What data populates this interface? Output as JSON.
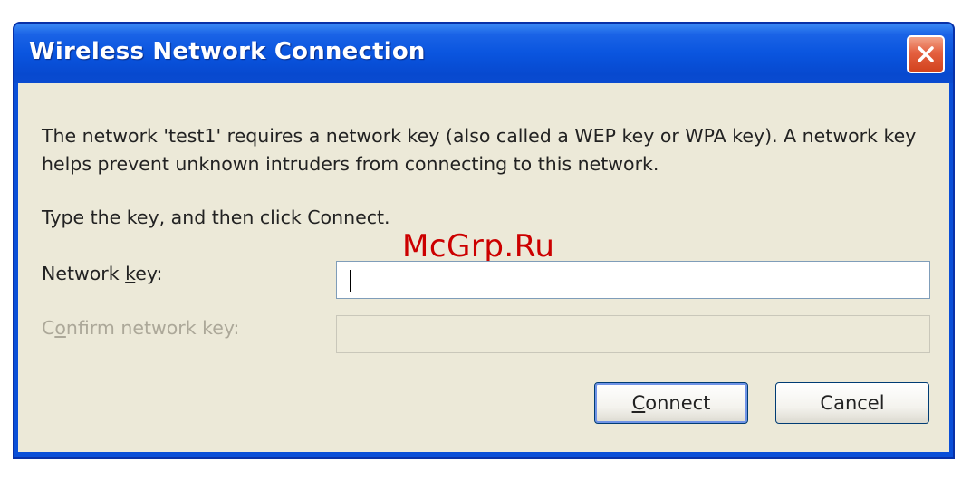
{
  "window": {
    "title": "Wireless Network Connection"
  },
  "message": {
    "line1": "The network 'test1' requires a network key (also called a WEP key or WPA key). A network key helps prevent unknown intruders from connecting to this network.",
    "line2": "Type the key, and then click Connect."
  },
  "watermark": "McGrp.Ru",
  "form": {
    "network_key": {
      "label_pre": "Network ",
      "label_access": "k",
      "label_post": "ey:",
      "value": ""
    },
    "confirm_key": {
      "label_pre": "C",
      "label_access": "o",
      "label_post": "nfirm network key:",
      "value": ""
    }
  },
  "buttons": {
    "connect_access": "C",
    "connect_rest": "onnect",
    "cancel": "Cancel"
  },
  "colors": {
    "title_bar": "#0a55df",
    "client_bg": "#ece9d8",
    "close_button": "#d2431e",
    "watermark": "#cc0000",
    "disabled_text": "#aca899"
  },
  "icons": {
    "close": "close-x-icon"
  }
}
